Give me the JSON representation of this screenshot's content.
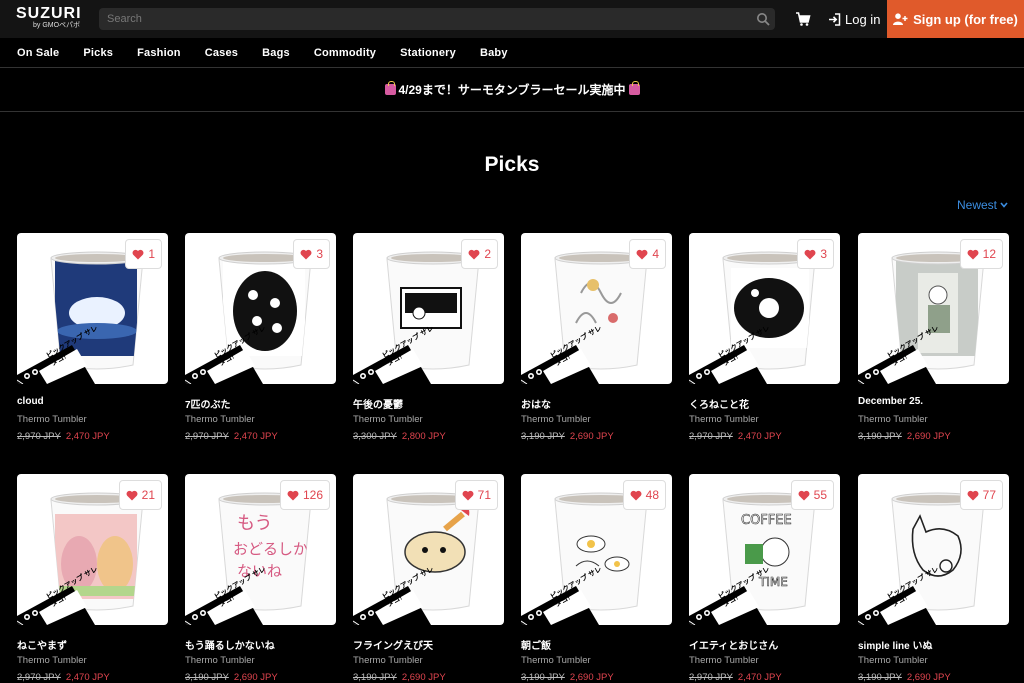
{
  "header": {
    "logo": "SUZURI",
    "logo_sub": "by GMOペパボ",
    "search_placeholder": "Search",
    "login_label": "Log in",
    "signup_label": "Sign up (for free)"
  },
  "categories": [
    "On Sale",
    "Picks",
    "Fashion",
    "Cases",
    "Bags",
    "Commodity",
    "Stationery",
    "Baby"
  ],
  "announcement": "4/29まで！サーモタンブラーセール実施中",
  "page_title": "Picks",
  "sort_label": "Newest",
  "pickup_badge": "ピックアップ サレタヨ!",
  "colors": {
    "accent": "#e05a2b",
    "sale": "#e0454f",
    "link": "#3b8de0"
  },
  "products": [
    {
      "name": "cloud",
      "type": "Thermo Tumbler",
      "old_price": "2,970 JPY",
      "price": "2,470 JPY",
      "likes": "1"
    },
    {
      "name": "7匹のぶた",
      "type": "Thermo Tumbler",
      "old_price": "2,970 JPY",
      "price": "2,470 JPY",
      "likes": "3"
    },
    {
      "name": "午後の憂鬱",
      "type": "Thermo Tumbler",
      "old_price": "3,300 JPY",
      "price": "2,800 JPY",
      "likes": "2"
    },
    {
      "name": "おはな",
      "type": "Thermo Tumbler",
      "old_price": "3,190 JPY",
      "price": "2,690 JPY",
      "likes": "4"
    },
    {
      "name": "くろねこと花",
      "type": "Thermo Tumbler",
      "old_price": "2,970 JPY",
      "price": "2,470 JPY",
      "likes": "3"
    },
    {
      "name": "December 25.",
      "type": "Thermo Tumbler",
      "old_price": "3,190 JPY",
      "price": "2,690 JPY",
      "likes": "12"
    },
    {
      "name": "ねこやまず",
      "type": "Thermo Tumbler",
      "old_price": "2,970 JPY",
      "price": "2,470 JPY",
      "likes": "21"
    },
    {
      "name": "もう踊るしかないね",
      "type": "Thermo Tumbler",
      "old_price": "3,190 JPY",
      "price": "2,690 JPY",
      "likes": "126"
    },
    {
      "name": "フライングえび天",
      "type": "Thermo Tumbler",
      "old_price": "3,190 JPY",
      "price": "2,690 JPY",
      "likes": "71"
    },
    {
      "name": "朝ご飯",
      "type": "Thermo Tumbler",
      "old_price": "3,190 JPY",
      "price": "2,690 JPY",
      "likes": "48"
    },
    {
      "name": "イエティとおじさん",
      "type": "Thermo Tumbler",
      "old_price": "2,970 JPY",
      "price": "2,470 JPY",
      "likes": "55"
    },
    {
      "name": "simple line いぬ",
      "type": "Thermo Tumbler",
      "old_price": "3,190 JPY",
      "price": "2,690 JPY",
      "likes": "77"
    }
  ]
}
